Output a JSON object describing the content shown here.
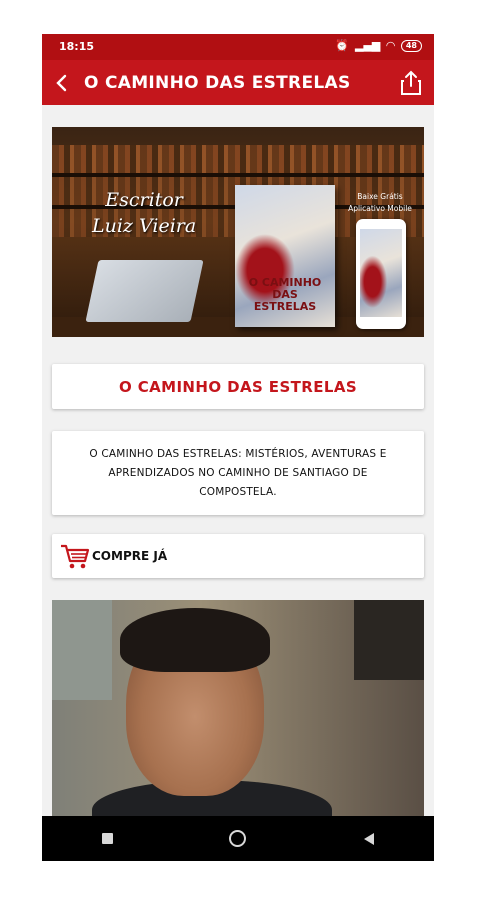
{
  "status_bar": {
    "time": "18:15",
    "battery": "48"
  },
  "app_bar": {
    "title": "O CAMINHO DAS ESTRELAS",
    "back_icon": "arrow-left-icon",
    "share_icon": "share-icon"
  },
  "banner": {
    "signature": "Escritor\nLuiz Vieira",
    "book_title": "O CAMINHO DAS ESTRELAS",
    "promo": "Baixe Grátis\nAplicativo Mobile"
  },
  "title_card": {
    "text": "O CAMINHO DAS ESTRELAS"
  },
  "description_card": {
    "text": "O CAMINHO DAS ESTRELAS: MISTÉRIOS, AVENTURAS E APRENDIZADOS NO CAMINHO DE SANTIAGO DE COMPOSTELA."
  },
  "buy_card": {
    "label": "COMPRE JÁ",
    "icon": "shopping-cart-icon"
  },
  "nav_bar": {
    "items": [
      "recents-square-icon",
      "home-circle-icon",
      "back-triangle-icon"
    ]
  },
  "colors": {
    "status_bar": "#b10f12",
    "app_bar": "#c4161c",
    "accent_text": "#c4161c",
    "background": "#f1f1f1"
  }
}
